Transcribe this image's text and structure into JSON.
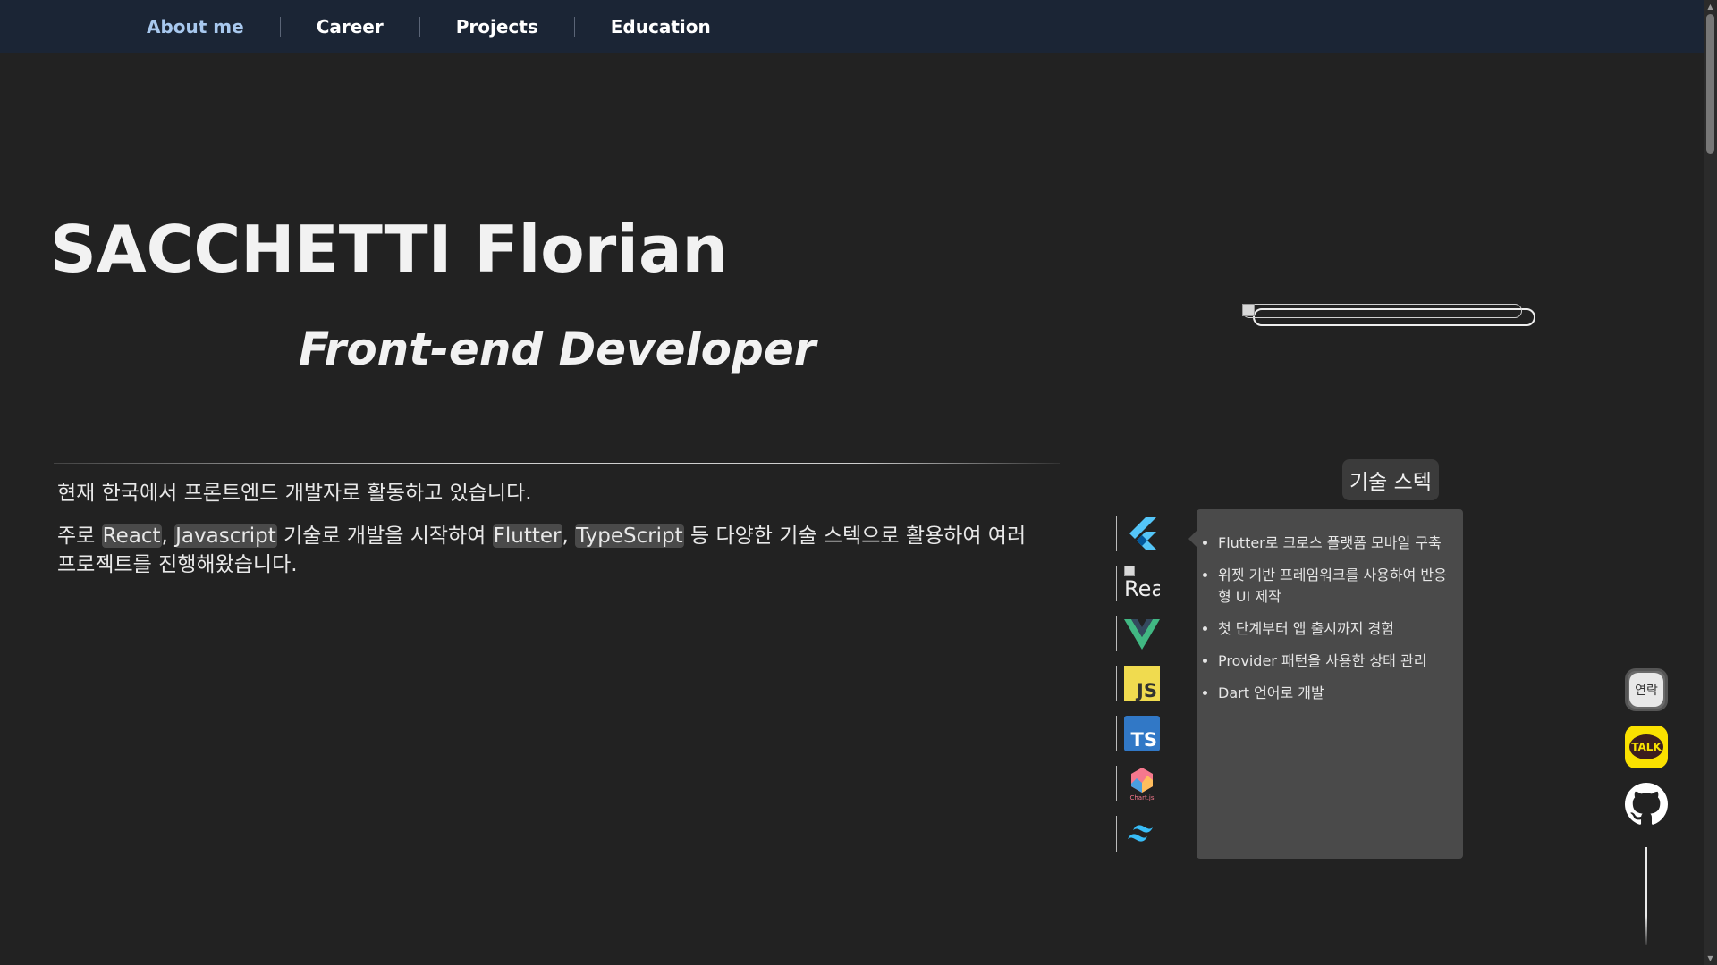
{
  "nav": {
    "items": [
      {
        "label": "About me",
        "active": true
      },
      {
        "label": "Career",
        "active": false
      },
      {
        "label": "Projects",
        "active": false
      },
      {
        "label": "Education",
        "active": false
      }
    ]
  },
  "hero": {
    "name": "SACCHETTI Florian",
    "role": "Front-end Developer"
  },
  "intro": {
    "line1": "현재 한국에서 프론트엔드 개발자로 활동하고 있습니다.",
    "line2_prefix": "주로 ",
    "tech_react": "React",
    "comma1": ", ",
    "tech_js": "Javascript",
    "line2_mid": " 기술로 개발을 시작하여 ",
    "tech_flutter": "Flutter",
    "comma2": ", ",
    "tech_ts": "TypeScript",
    "line2_suffix": " 등 다양한 기술 스텍으로 활용하여 여러 프로젝트를 진행해왔습니다."
  },
  "stack": {
    "title": "기술 스텍",
    "icons": [
      {
        "name": "flutter-icon"
      },
      {
        "name": "react-icon",
        "alt": "React"
      },
      {
        "name": "vue-icon"
      },
      {
        "name": "javascript-icon",
        "text": "JS"
      },
      {
        "name": "typescript-icon",
        "text": "TS"
      },
      {
        "name": "chartjs-icon",
        "text": "Chart.js"
      },
      {
        "name": "tailwind-icon"
      }
    ],
    "details": [
      "Flutter로 크로스 플랫폼 모바일 구축",
      "위젯 기반 프레임워크를 사용하여 반응형 UI 제작",
      "첫 단계부터 앱 출시까지 경험",
      "Provider 패턴을 사용한 상태 관리",
      "Dart 언어로 개발"
    ]
  },
  "floating": {
    "contact_label": "연락",
    "talk_label": "TALK"
  },
  "colors": {
    "background": "#222222",
    "nav": "#1b2535",
    "nav_active": "#a8c8ee",
    "highlight": "#4a4a4a",
    "kakao": "#fae100"
  }
}
